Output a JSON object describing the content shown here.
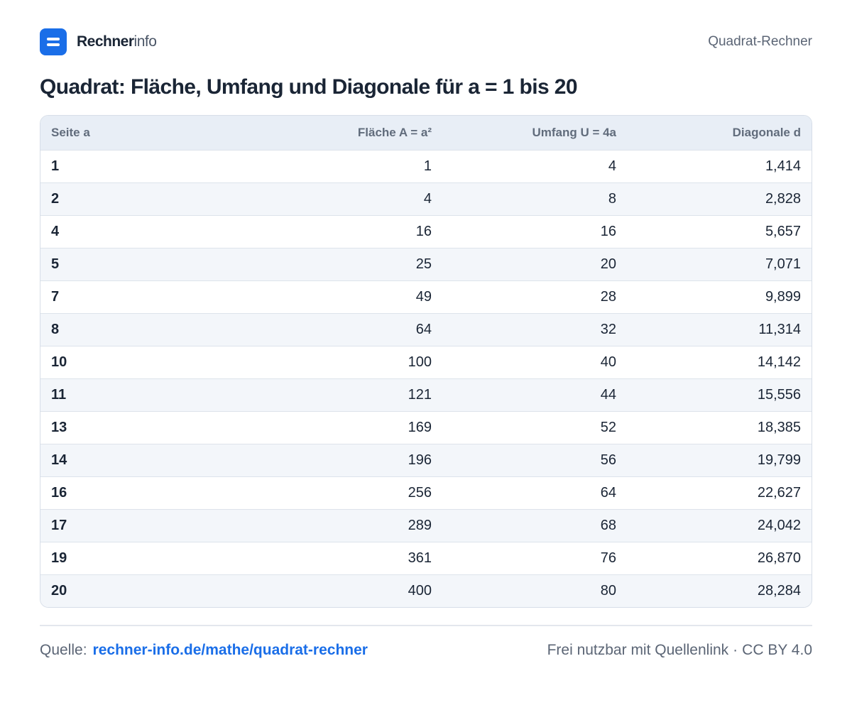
{
  "header": {
    "brand_strong": "Rechner",
    "brand_light": "info",
    "right_label": "Quadrat-Rechner"
  },
  "title": "Quadrat: Fläche, Umfang und Diagonale für a = 1 bis 20",
  "table": {
    "columns": [
      "Seite a",
      "Fläche A = a²",
      "Umfang U = 4a",
      "Diagonale d"
    ],
    "rows": [
      [
        "1",
        "1",
        "4",
        "1,414"
      ],
      [
        "2",
        "4",
        "8",
        "2,828"
      ],
      [
        "4",
        "16",
        "16",
        "5,657"
      ],
      [
        "5",
        "25",
        "20",
        "7,071"
      ],
      [
        "7",
        "49",
        "28",
        "9,899"
      ],
      [
        "8",
        "64",
        "32",
        "11,314"
      ],
      [
        "10",
        "100",
        "40",
        "14,142"
      ],
      [
        "11",
        "121",
        "44",
        "15,556"
      ],
      [
        "13",
        "169",
        "52",
        "18,385"
      ],
      [
        "14",
        "196",
        "56",
        "19,799"
      ],
      [
        "16",
        "256",
        "64",
        "22,627"
      ],
      [
        "17",
        "289",
        "68",
        "24,042"
      ],
      [
        "19",
        "361",
        "76",
        "26,870"
      ],
      [
        "20",
        "400",
        "80",
        "28,284"
      ]
    ]
  },
  "footer": {
    "source_label": "Quelle:",
    "source_link": "rechner-info.de/mathe/quadrat-rechner",
    "license_text": "Frei nutzbar mit Quellenlink",
    "separator": "·",
    "license_name": "CC BY 4.0"
  },
  "colors": {
    "accent": "#1a6ee8",
    "header_row": "#e8eef6",
    "stripe_row": "#f3f6fa"
  },
  "icons": {
    "logo": "rechnerinfo-logo-icon"
  }
}
